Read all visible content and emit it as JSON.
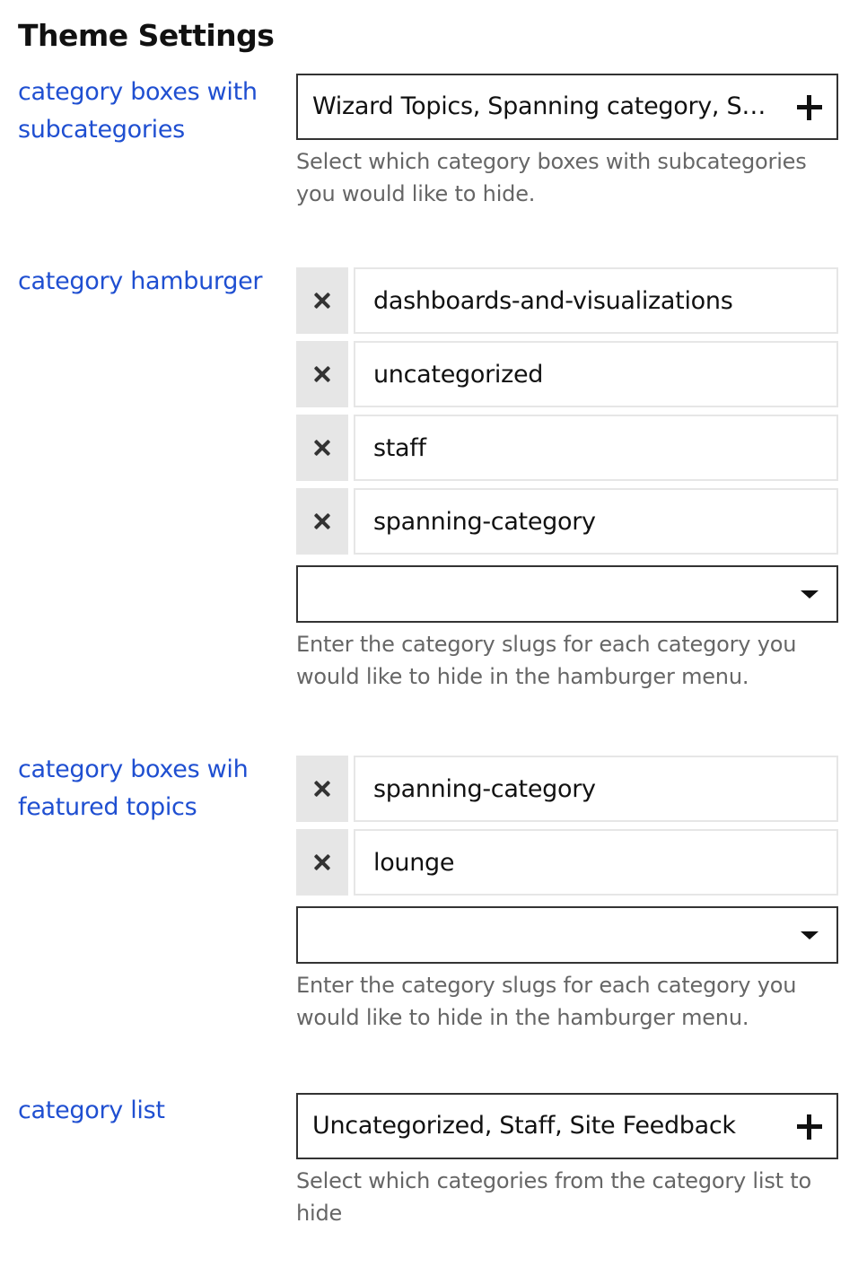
{
  "page_title": "Theme Settings",
  "settings": {
    "subcategory_boxes": {
      "label": "category boxes with subcategories",
      "selected_value": "Wizard Topics, Spanning category, Staff, Lounge",
      "add_icon": "plus-icon",
      "help": "Select which category boxes with subcategories you would like to hide."
    },
    "hamburger": {
      "label": "category hamburger",
      "items": [
        {
          "value": "dashboards-and-visualizations"
        },
        {
          "value": "uncategorized"
        },
        {
          "value": "staff"
        },
        {
          "value": "spanning-category"
        }
      ],
      "remove_icon": "x-icon",
      "dropdown_icon": "caret-down-icon",
      "help": "Enter the category slugs for each category you would like to hide in the hamburger menu."
    },
    "featured_boxes": {
      "label": "category boxes wih featured topics",
      "items": [
        {
          "value": "spanning-category"
        },
        {
          "value": "lounge"
        }
      ],
      "remove_icon": "x-icon",
      "dropdown_icon": "caret-down-icon",
      "help": "Enter the category slugs for each category you would like to hide in the hamburger menu."
    },
    "category_list": {
      "label": "category list",
      "selected_value": "Uncategorized, Staff, Site Feedback",
      "add_icon": "plus-icon",
      "help": "Select which categories from the category list to hide"
    }
  },
  "colors": {
    "label_link": "#1f4fd1",
    "help_text": "#666666",
    "border": "#333333",
    "remove_bg": "#e6e6e6"
  }
}
